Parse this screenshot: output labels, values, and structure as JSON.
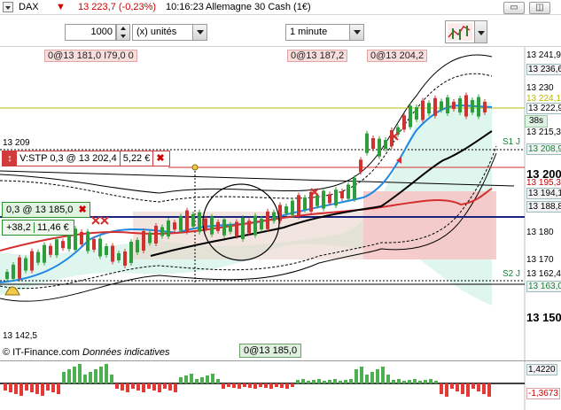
{
  "titlebar": {
    "instrument": "DAX",
    "price_change": "13 223,7 (-0,23%)",
    "time": "10:16:23",
    "market_name": "Allemagne 30 Cash (1€)"
  },
  "toolbar": {
    "quantity": "1000",
    "unit": "(x) unités",
    "timeframe": "1 minute"
  },
  "orders": {
    "tag1": "0@13 181,0 I79,0 0",
    "tag2": "0@13 187,2",
    "tag3": "0@13 204,2",
    "stop_label": "V:STP",
    "stop_value": "0,3 @ 13 202,4",
    "stop_amount": "5,22 €",
    "position": "0,3 @ 13 185,0",
    "pnl_points": "+38,2",
    "pnl_euro": "11,46 €",
    "footer_order": "0@13 185,0"
  },
  "chart": {
    "label_13209": "13 209",
    "label_1425": "13 142,5",
    "pivot_s1": "S1 J",
    "pivot_s2": "S2 J",
    "timer": "38s",
    "source": "© IT-Finance.com",
    "indicative": "Données indicatives",
    "price_labels": {
      "p1": "13 241,9",
      "p2": "13 236,6",
      "p3": "13 230",
      "p4": "13 224,1",
      "p5": "13 222,9",
      "p6": "13 215,3",
      "p7": "13 208,9",
      "p8": "13 200",
      "p9": "13 195,3",
      "p10": "13 194,1",
      "p11": "13 188,8",
      "p12": "13 180",
      "p13": "13 170",
      "p14": "13 162,4",
      "p15": "13 163,0",
      "p16": "13 150"
    }
  },
  "oscillator": {
    "upper": "1,4220",
    "lower": "-1,3673"
  },
  "colors": {
    "bollinger_fill": "#dff6ee",
    "band_line": "#000000",
    "ema_fast": "#1e88e5",
    "ema_mid": "#d32f2f",
    "ema_slow": "#000000",
    "candle_up": "#2e9e3a",
    "candle_down": "#d0322f",
    "hist_up": "#4caf50",
    "hist_down": "#e53935",
    "stop_zone": "#f6c6c6"
  }
}
